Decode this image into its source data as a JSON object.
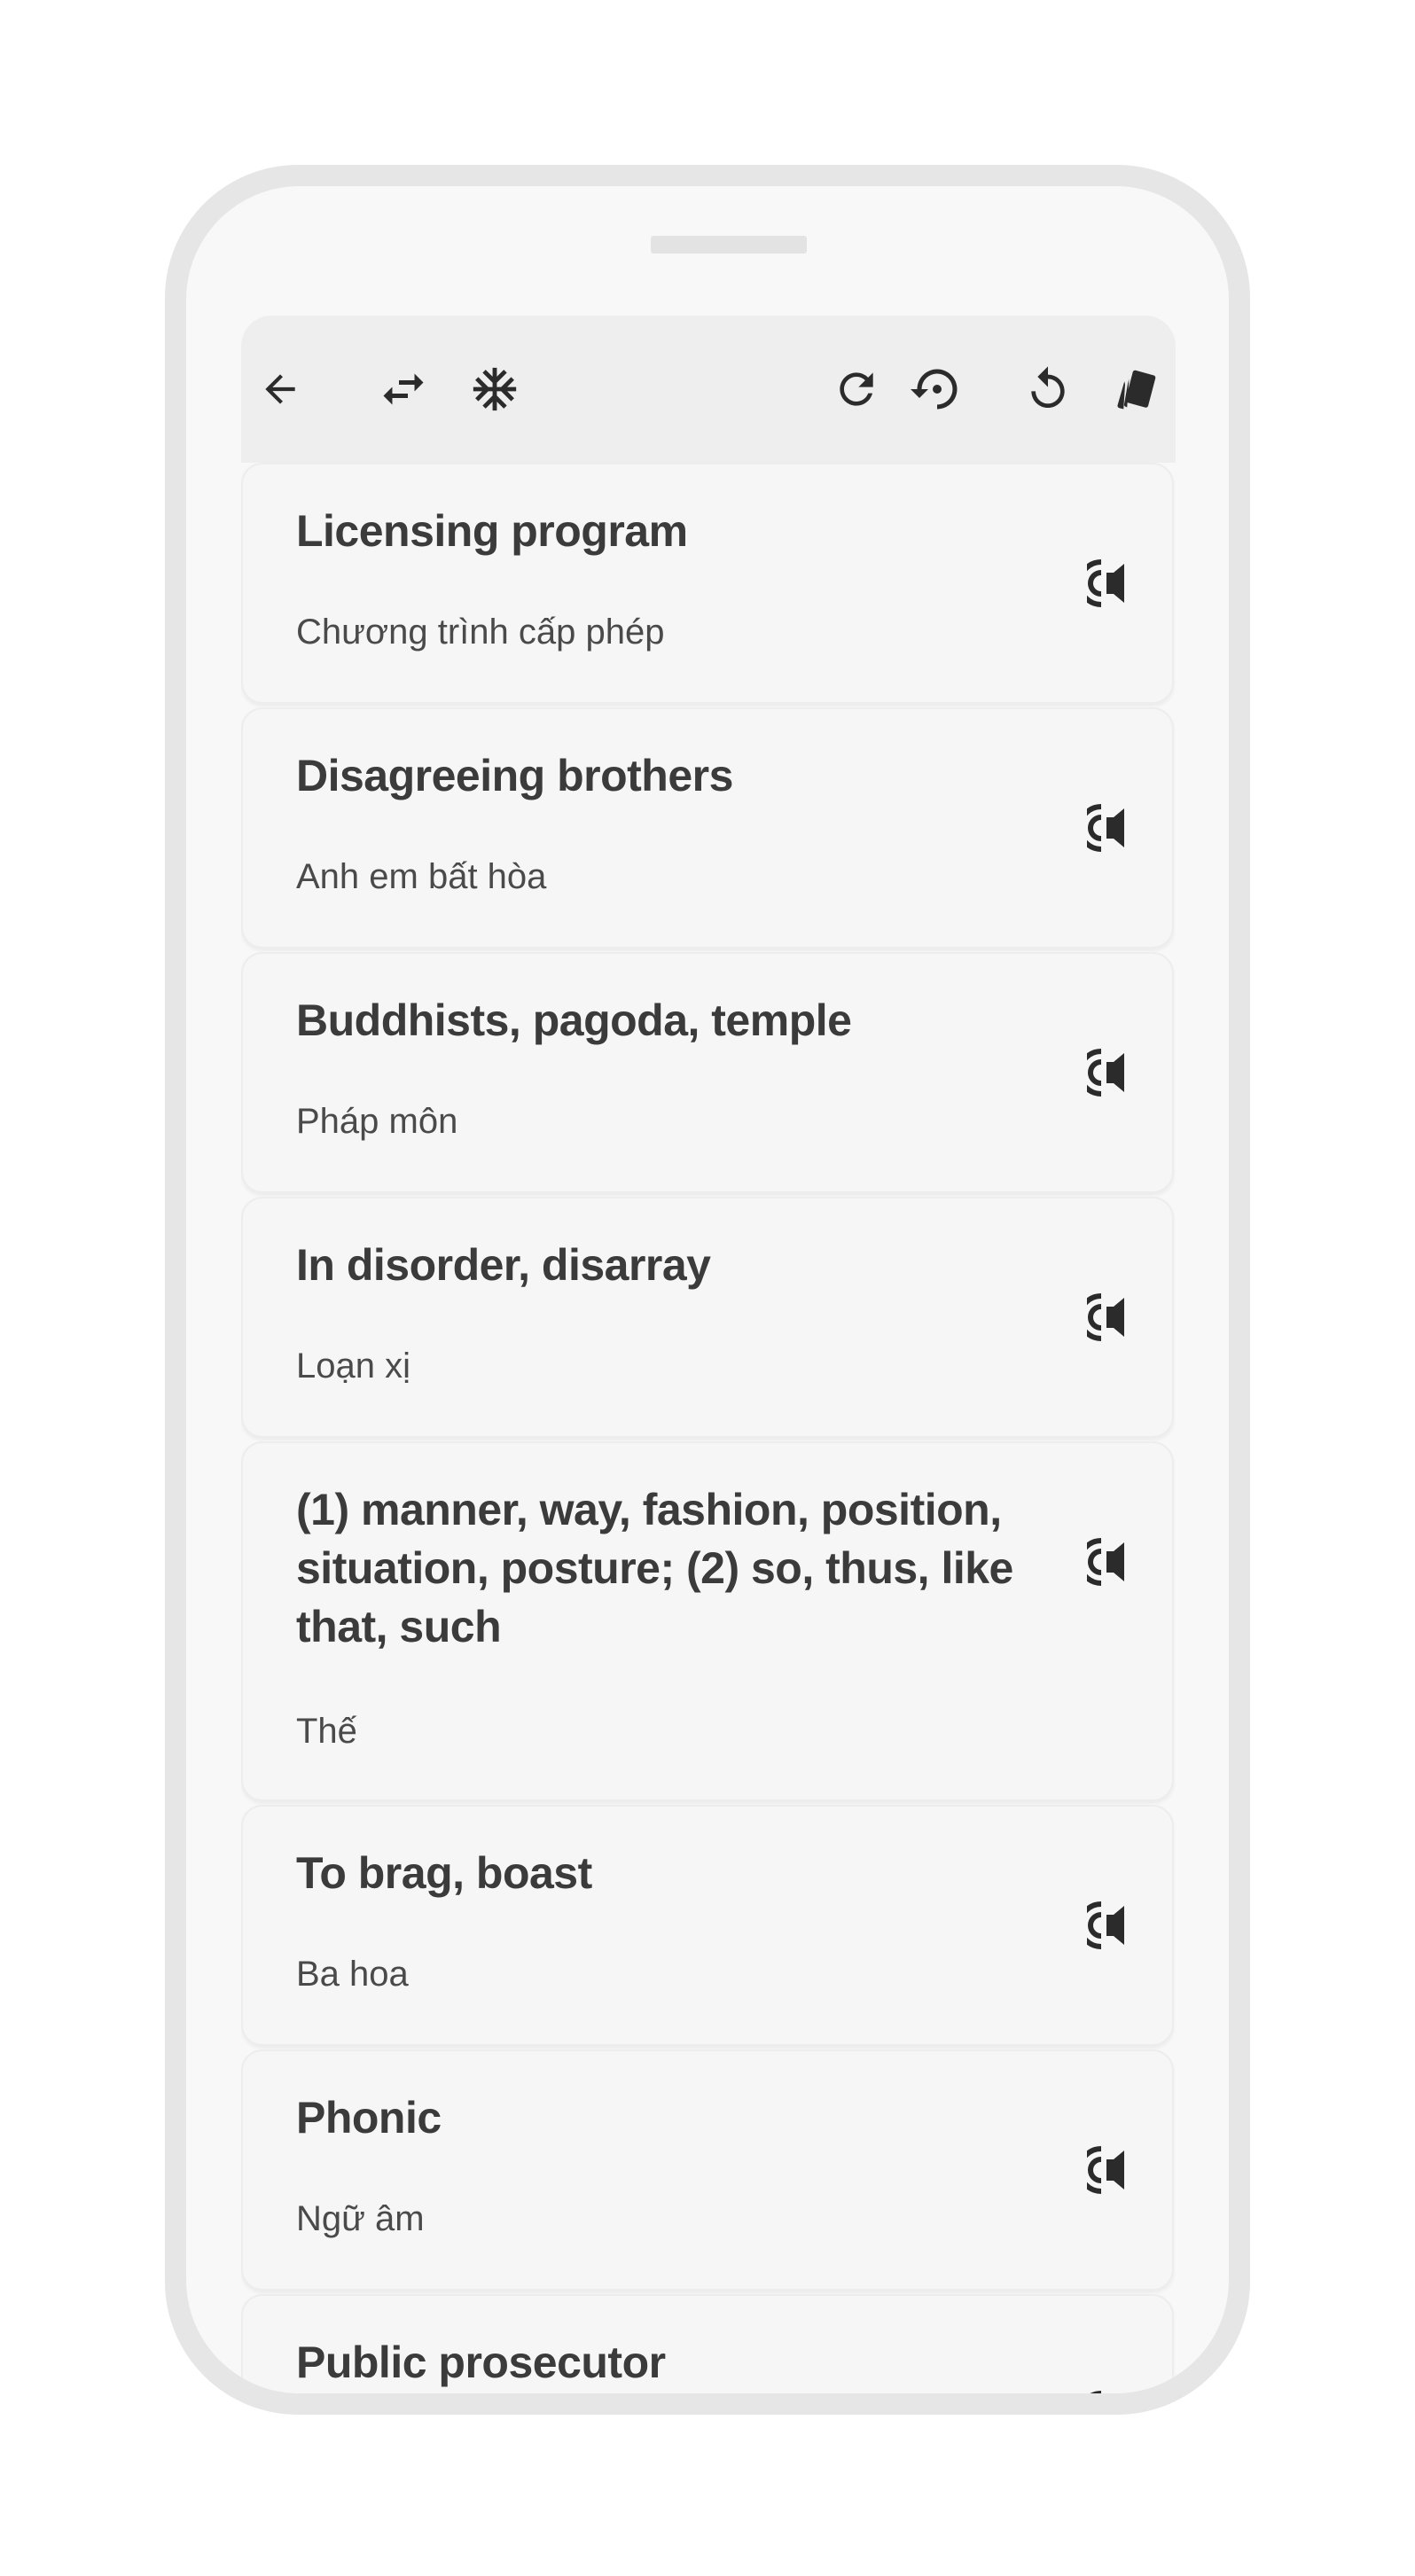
{
  "toolbar": {
    "back_icon": "arrow-left-icon",
    "swap_icon": "swap-arrows-icon",
    "freeze_icon": "snowflake-icon",
    "refresh_icon": "refresh-icon",
    "history_icon": "restore-history-icon",
    "rotate_icon": "rotate-icon",
    "cards_icon": "cards-icon"
  },
  "cards": [
    {
      "english": "Licensing program",
      "vietnamese": "Chương trình cấp phép"
    },
    {
      "english": "Disagreeing brothers",
      "vietnamese": "Anh em bất hòa"
    },
    {
      "english": "Buddhists, pagoda, temple",
      "vietnamese": "Pháp môn"
    },
    {
      "english": "In disorder, disarray",
      "vietnamese": "Loạn xị"
    },
    {
      "english": "(1) manner, way, fashion, position, situation, posture; (2) so, thus, like that, such",
      "vietnamese": "Thế"
    },
    {
      "english": "To brag, boast",
      "vietnamese": "Ba hoa"
    },
    {
      "english": "Phonic",
      "vietnamese": "Ngữ âm"
    },
    {
      "english": "Public prosecutor",
      "vietnamese": ""
    }
  ],
  "colors": {
    "frame": "#e6e6e6",
    "screen": "#f8f8f8",
    "toolbar": "#eeeeee",
    "card": "#f6f6f6",
    "title_text": "#3b3b3b",
    "subtitle_text": "#4a4a4a",
    "icon": "#2b2b2b"
  }
}
